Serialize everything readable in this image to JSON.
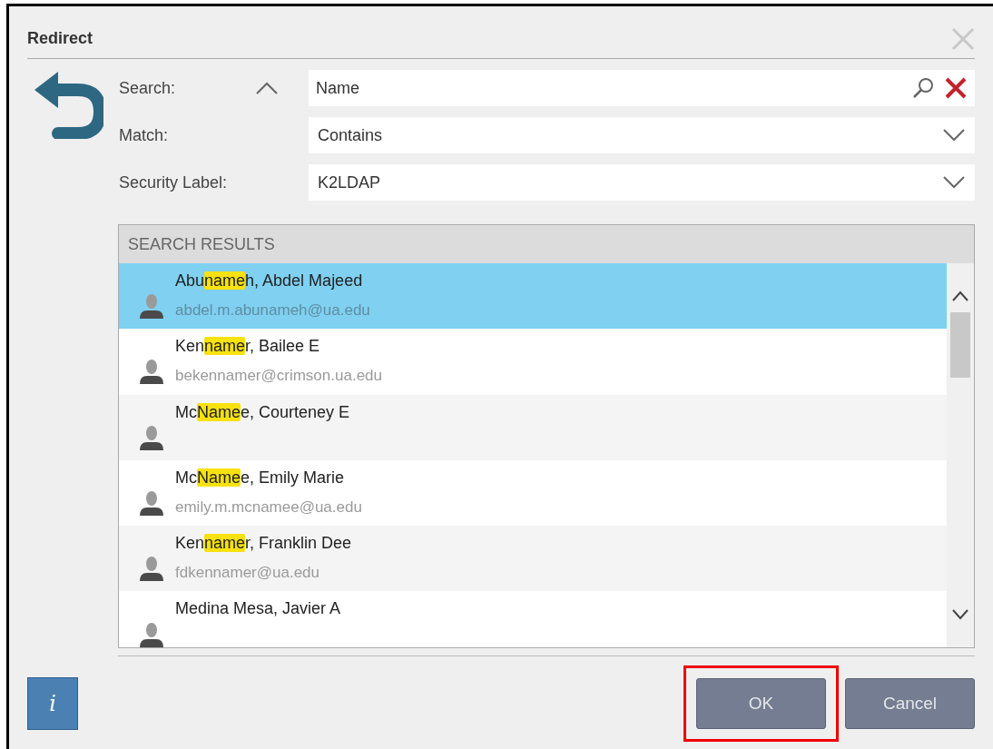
{
  "dialog": {
    "title": "Redirect"
  },
  "form": {
    "search_label": "Search:",
    "search_value": "Name",
    "search_expanded": true,
    "match_label": "Match:",
    "match_value": "Contains",
    "security_label": "Security Label:",
    "security_value": "K2LDAP"
  },
  "results": {
    "header": "SEARCH RESULTS",
    "rows": [
      {
        "before": "Abu",
        "match": "name",
        "after": "h, Abdel Majeed",
        "email": "abdel.m.abunameh@ua.edu",
        "selected": true
      },
      {
        "before": "Ken",
        "match": "name",
        "after": "r, Bailee E",
        "email": "bekennamer@crimson.ua.edu",
        "selected": false
      },
      {
        "before": "Mc",
        "match": "Name",
        "after": "e, Courteney E",
        "selected": false
      },
      {
        "before": "Mc",
        "match": "Name",
        "after": "e, Emily Marie",
        "email": "emily.m.mcnamee@ua.edu",
        "selected": false
      },
      {
        "before": "Ken",
        "match": "name",
        "after": "r, Franklin Dee",
        "email": "fdkennamer@ua.edu",
        "selected": false
      },
      {
        "before": "Medina Mesa, Javier A",
        "selected": false
      }
    ]
  },
  "buttons": [
    {
      "label": "OK",
      "annotated": true
    },
    {
      "label": "Cancel",
      "annotated": false
    }
  ],
  "info_button": {
    "label": "i"
  }
}
